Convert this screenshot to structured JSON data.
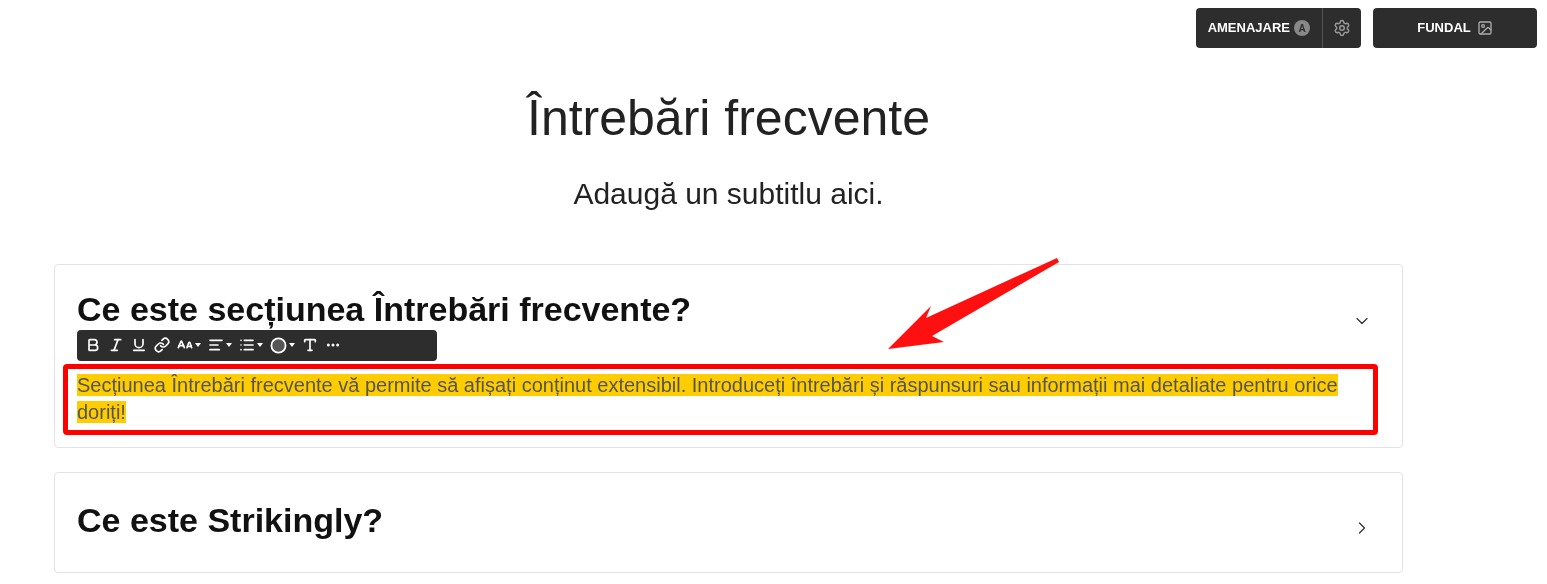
{
  "top_buttons": [
    {
      "label": "AMENAJARE",
      "kind": "style",
      "badge": "A"
    },
    {
      "label": "FUNDAL",
      "kind": "background"
    }
  ],
  "title": "Întrebări frecvente",
  "subtitle": "Adaugă un subtitlu aici.",
  "toolbar": [
    {
      "kind": "bold",
      "dropdown": false
    },
    {
      "kind": "italic",
      "dropdown": false
    },
    {
      "kind": "underline",
      "dropdown": false
    },
    {
      "kind": "link",
      "dropdown": false
    },
    {
      "kind": "font-size",
      "dropdown": true
    },
    {
      "kind": "align",
      "dropdown": true
    },
    {
      "kind": "list",
      "dropdown": true
    },
    {
      "kind": "color",
      "dropdown": true
    },
    {
      "kind": "text-style",
      "dropdown": false
    },
    {
      "kind": "more",
      "dropdown": false
    }
  ],
  "faq": [
    {
      "question": "Ce este secțiunea Întrebări frecvente?",
      "expanded": true,
      "answer": "Secțiunea Întrebări frecvente vă permite să afișați conținut extensibil. Introduceți întrebări și răspunsuri sau informații mai detaliate pentru orice doriți!",
      "answer_selected": true
    },
    {
      "question": "Ce este Strikingly?",
      "expanded": false
    }
  ]
}
